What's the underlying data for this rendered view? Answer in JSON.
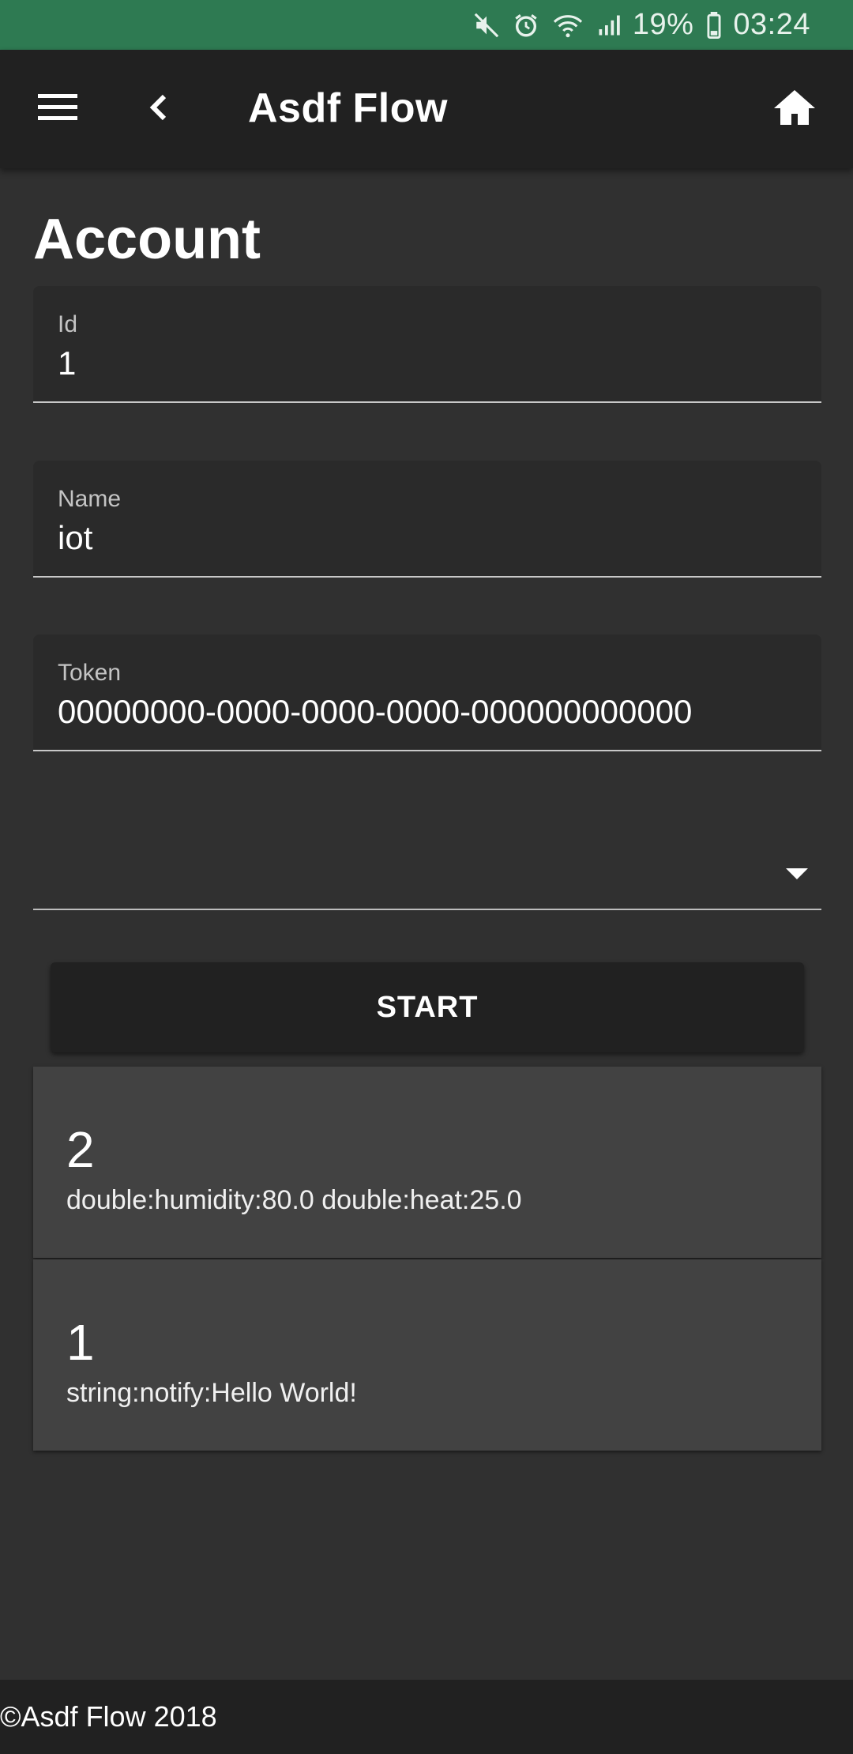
{
  "status_bar": {
    "battery": "19%",
    "time": "03:24",
    "icons": [
      "mute-icon",
      "alarm-icon",
      "wifi-icon",
      "signal-icon",
      "battery-icon"
    ],
    "color": "#2e7a52"
  },
  "app_bar": {
    "title": "Asdf Flow",
    "icons": [
      "menu-icon",
      "back-icon",
      "home-icon"
    ]
  },
  "page": {
    "title": "Account"
  },
  "form": {
    "id": {
      "label": "Id",
      "value": "1"
    },
    "name": {
      "label": "Name",
      "value": "iot"
    },
    "token": {
      "label": "Token",
      "value": "00000000-0000-0000-0000-000000000000"
    },
    "select": {
      "value": ""
    },
    "start_label": "START"
  },
  "events": [
    {
      "number": "2",
      "text": "double:humidity:80.0 double:heat:25.0"
    },
    {
      "number": "1",
      "text": "string:notify:Hello World!"
    }
  ],
  "footer": {
    "text": "©Asdf Flow 2018"
  }
}
